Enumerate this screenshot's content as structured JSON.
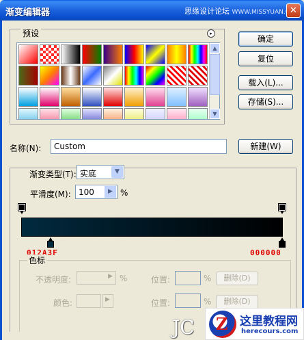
{
  "window": {
    "title": "渐变编辑器",
    "site_text": "思缘设计论坛",
    "site_watermark": "WWW.MISSYUAN.COM",
    "close_glyph": "✕"
  },
  "presets": {
    "legend": "预设",
    "menu_glyph": "▸",
    "scroll_up": "▲",
    "scroll_down": "▼",
    "swatches": [
      "linear-gradient(135deg,#ffffff,#ff0000)",
      "repeating-conic-gradient(#ff2a2a 0% 25%, #ffffff 0% 50%) 0 0/8px 8px",
      "linear-gradient(to right,#ffffff,#000000)",
      "linear-gradient(to right,#ff0000,#008000)",
      "linear-gradient(to right,#3a0087,#ff7f00)",
      "linear-gradient(to right,#0000ff,#ff0000,#ffff00)",
      "linear-gradient(135deg,#0000ff,#ffff00,#0000ff)",
      "linear-gradient(to right,#ff8000,#ffff00,#ff8000)",
      "linear-gradient(to right,#ff0000,#ffff00,#00ff00,#00ffff,#0000ff,#ff00ff,#ff0000)",
      "linear-gradient(to right,#ff0000,#0000ff)",
      "linear-gradient(to right,#4a6b1a,#a40000)",
      "linear-gradient(135deg,#ffff00,#ff8000,#ff00ff)",
      "linear-gradient(to right,#6b3b1b,#ffffff,#6b3b1b)",
      "linear-gradient(135deg,#ffffff,#3b6aff,#ffffff)",
      "linear-gradient(135deg,#808080,#ffffff,#e0e000)",
      "linear-gradient(to right,#ff0000,#ffff00,#00ff00,#00ffff,#0000ff,#ff00ff)",
      "linear-gradient(135deg,#ff0000,#ffff00,#00ff00,#0000ff,#ff00ff)",
      "repeating-linear-gradient(45deg,#ffffff 0 3px,#ff0000 3px 6px)",
      "repeating-linear-gradient(45deg,#ffffff 0 3px,#e00000 3px 6px)",
      "linear-gradient(to right,#ffffff,#3b9aff)",
      "linear-gradient(to bottom,#ffffff,#00a0e0)",
      "linear-gradient(to bottom,#ffffff,#e0006a)",
      "linear-gradient(to bottom,#ffe0a0,#c06000)",
      "linear-gradient(to bottom,#ffffff,#3050c0)",
      "linear-gradient(to bottom,#ffe0e0,#e00000)",
      "linear-gradient(to bottom,#fff0d0,#f0a000)",
      "linear-gradient(to bottom,#ffe0f0,#e04090)",
      "linear-gradient(to bottom,#e0f0ff,#80c0ff)",
      "linear-gradient(to bottom,#f0e0ff,#a060c0)",
      "linear-gradient(to bottom,#ffffff,#808080)",
      "linear-gradient(to bottom,#e0f8ff,#40b0e0)",
      "linear-gradient(to bottom,#ffe0e8,#f06080)",
      "linear-gradient(to bottom,#e0ffe0,#40c040)",
      "linear-gradient(to bottom,#e0e0ff,#4040c0)",
      "linear-gradient(to bottom,#fff0e0,#f08040)",
      "linear-gradient(to bottom,#ffffe0,#e0e040)",
      "linear-gradient(to bottom,#f0f0ff,#c0c0ff)",
      "linear-gradient(to bottom,#ffe8f0,#ff80b0)",
      "linear-gradient(to bottom,#e8fff0,#80ffb0)",
      "repeating-linear-gradient(45deg,#ffffff 0 3px,#404040 3px 6px)"
    ]
  },
  "buttons": {
    "ok": "确定",
    "reset": "复位",
    "load": "载入(L)...",
    "save": "存储(S)...",
    "new": "新建(W)"
  },
  "name": {
    "label": "名称(N):",
    "value": "Custom"
  },
  "gradient": {
    "type_label": "渐变类型(T):",
    "type_value": "实底",
    "dropdown_glyph": "▼",
    "smoothness_label": "平滑度(M):",
    "smoothness_value": "100",
    "smoothness_arrow": "▶",
    "percent": "%",
    "colors": {
      "start": "#012A3F",
      "end": "#000000"
    },
    "start_hex_label": "012A3F",
    "end_hex_label": "000000"
  },
  "color_stops": {
    "legend": "色标",
    "opacity_label": "不透明度:",
    "opacity_arrow": "▶",
    "color_label": "颜色:",
    "color_arrow": "▶",
    "percent": "%",
    "location_label": "位置:",
    "delete_label": "删除(D)"
  },
  "watermarks": {
    "jc": "JC",
    "logo_glyph": "Z",
    "site_name": "这里教程网",
    "site_url": "herecours.com"
  }
}
